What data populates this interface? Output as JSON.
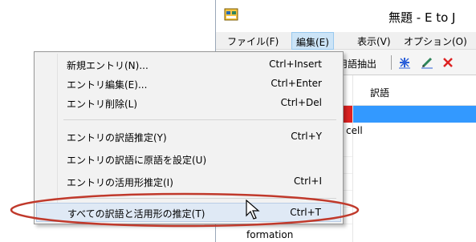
{
  "app": {
    "title": "無題 - E to J",
    "icon": "app-icon"
  },
  "menu_bar": {
    "file": "ファイル(F)",
    "edit": "編集(E)",
    "view": "表示(V)",
    "options": "オプション(O)"
  },
  "toolbar": {
    "extract_label": "用語抽出",
    "icons": [
      "add-entry-icon",
      "edit-entry-icon",
      "delete-entry-icon"
    ]
  },
  "table": {
    "translation_header": "訳語",
    "rows": [
      {
        "source": "cell",
        "translation": ""
      },
      {
        "source": "cell",
        "translation": ""
      }
    ],
    "last_row_source": "formation"
  },
  "dropdown": {
    "items": [
      {
        "label": "新規エントリ(N)...",
        "shortcut": "Ctrl+Insert"
      },
      {
        "label": "エントリ編集(E)...",
        "shortcut": "Ctrl+Enter"
      },
      {
        "label": "エントリ削除(L)",
        "shortcut": "Ctrl+Del"
      },
      {
        "label": "エントリの訳語推定(Y)",
        "shortcut": "Ctrl+Y"
      },
      {
        "label": "エントリの訳語に原語を設定(U)",
        "shortcut": ""
      },
      {
        "label": "エントリの活用形推定(I)",
        "shortcut": "Ctrl+I"
      },
      {
        "label": "すべての訳語と活用形の推定(T)",
        "shortcut": "Ctrl+T"
      }
    ],
    "highlighted_item": "すべての訳語と活用形の推定(T)"
  },
  "colors": {
    "selected_row_source": "#dd2222",
    "selected_row_translation": "#3399ff",
    "annotation_ellipse": "#c0392b",
    "menu_active": "#cce4f7"
  }
}
